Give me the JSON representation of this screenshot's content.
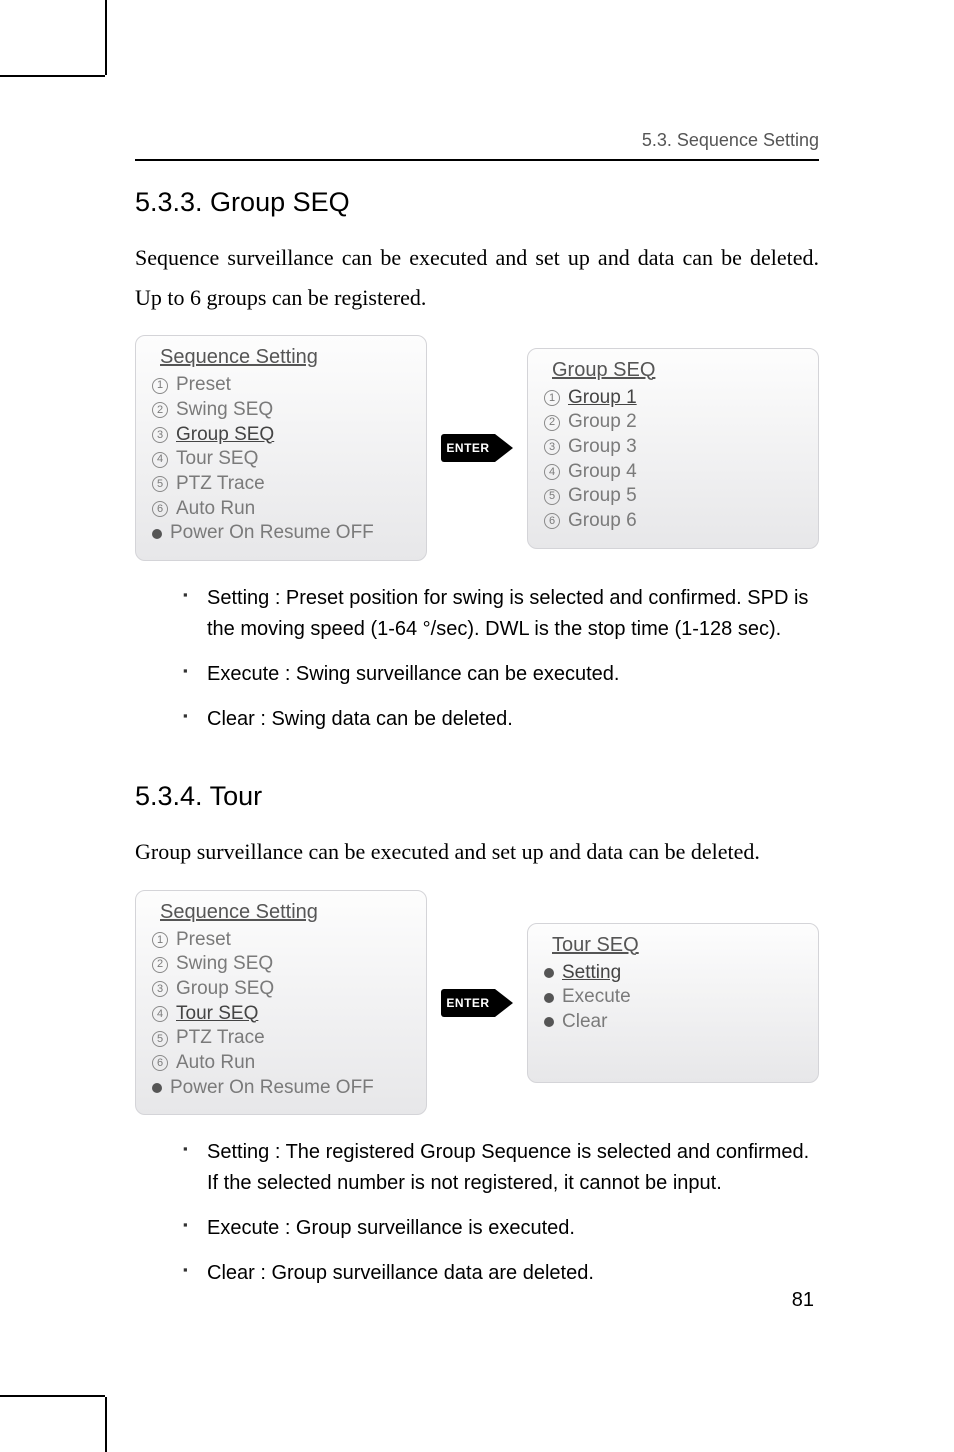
{
  "running_head": "5.3. Sequence Setting",
  "page_number": "81",
  "section_533": {
    "heading": "5.3.3. Group SEQ",
    "intro": "Sequence surveillance can be executed and set up and data can be deleted. Up to 6 groups can be registered.",
    "left_panel": {
      "title": "Sequence Setting",
      "items": [
        {
          "num": "1",
          "label": "Preset",
          "selected": false
        },
        {
          "num": "2",
          "label": "Swing SEQ",
          "selected": false
        },
        {
          "num": "3",
          "label": "Group SEQ",
          "selected": true
        },
        {
          "num": "4",
          "label": "Tour SEQ",
          "selected": false
        },
        {
          "num": "5",
          "label": "PTZ Trace",
          "selected": false
        },
        {
          "num": "6",
          "label": "Auto Run",
          "selected": false
        },
        {
          "num": "dot",
          "label": "Power On Resume OFF",
          "selected": false
        }
      ]
    },
    "enter_label": "ENTER",
    "right_panel": {
      "title": "Group SEQ",
      "items": [
        {
          "num": "1",
          "label": "Group 1",
          "selected": true
        },
        {
          "num": "2",
          "label": "Group 2",
          "selected": false
        },
        {
          "num": "3",
          "label": "Group 3",
          "selected": false
        },
        {
          "num": "4",
          "label": "Group 4",
          "selected": false
        },
        {
          "num": "5",
          "label": "Group 5",
          "selected": false
        },
        {
          "num": "6",
          "label": "Group 6",
          "selected": false
        }
      ]
    },
    "bullets": [
      "Setting : Preset position for swing is selected and confirmed. SPD is the moving speed (1-64 °/sec). DWL is the stop time (1-128 sec).",
      "Execute : Swing surveillance can be executed.",
      "Clear : Swing data can be deleted."
    ]
  },
  "section_534": {
    "heading": "5.3.4. Tour",
    "intro": "Group surveillance can be executed and set up and data can be deleted.",
    "left_panel": {
      "title": "Sequence Setting",
      "items": [
        {
          "num": "1",
          "label": "Preset",
          "selected": false
        },
        {
          "num": "2",
          "label": "Swing SEQ",
          "selected": false
        },
        {
          "num": "3",
          "label": "Group SEQ",
          "selected": false
        },
        {
          "num": "4",
          "label": "Tour SEQ",
          "selected": true
        },
        {
          "num": "5",
          "label": "PTZ Trace",
          "selected": false
        },
        {
          "num": "6",
          "label": "Auto Run",
          "selected": false
        },
        {
          "num": "dot",
          "label": "Power On Resume OFF",
          "selected": false
        }
      ]
    },
    "enter_label": "ENTER",
    "right_panel": {
      "title": "Tour SEQ",
      "items": [
        {
          "num": "dot",
          "label": "Setting",
          "selected": true
        },
        {
          "num": "dot",
          "label": "Execute",
          "selected": false
        },
        {
          "num": "dot",
          "label": "Clear",
          "selected": false
        }
      ]
    },
    "bullets": [
      "Setting : The registered Group Sequence is selected and confirmed. If the selected number is not registered, it cannot be input.",
      "Execute : Group surveillance is executed.",
      "Clear : Group surveillance data are deleted."
    ]
  }
}
